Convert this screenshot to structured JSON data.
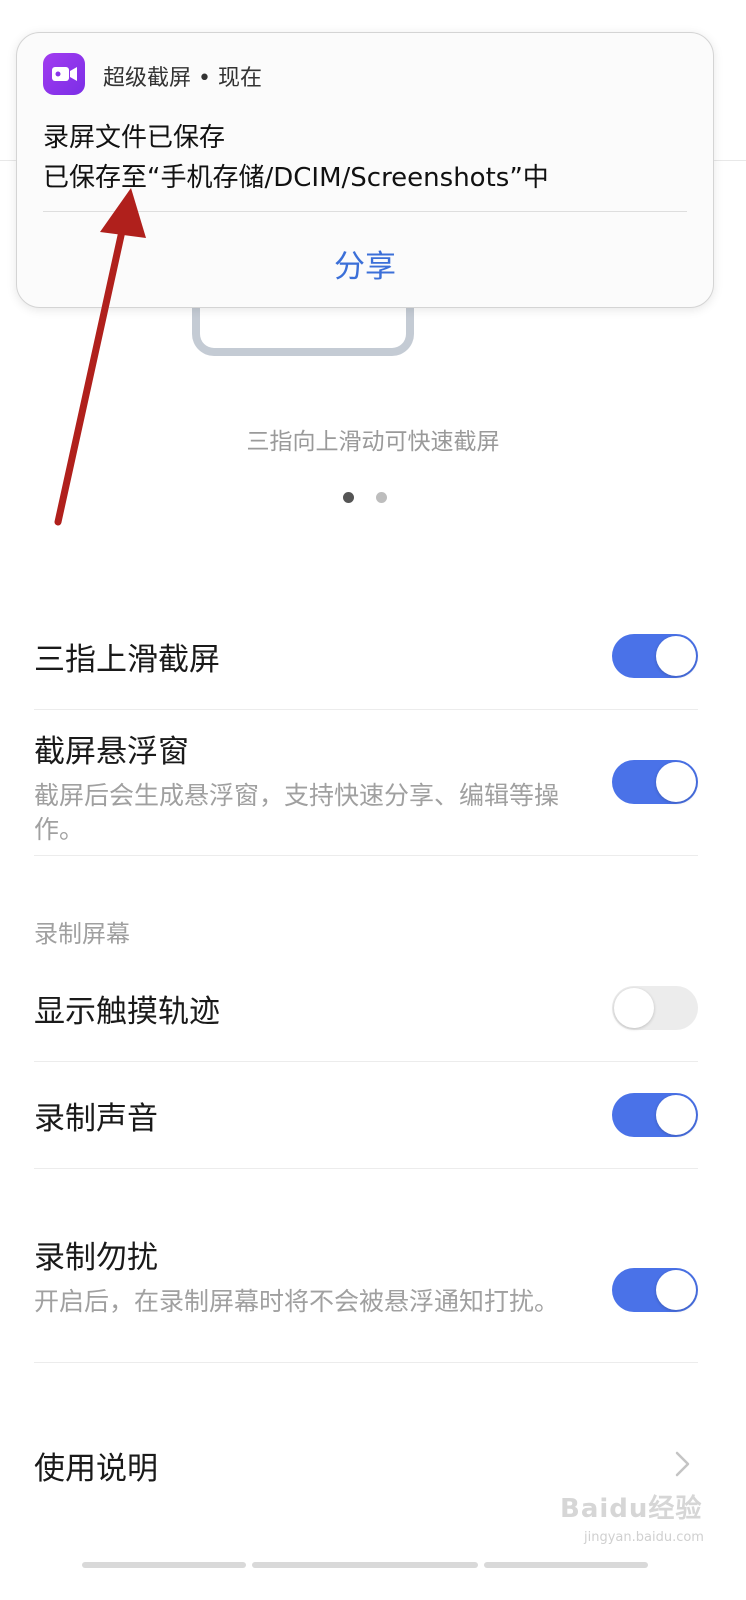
{
  "notification": {
    "app_name": "超级截屏 • 现在",
    "title": "录屏文件已保存",
    "body": "已保存至“手机存储/DCIM/Screenshots”中",
    "action_share": "分享",
    "app_icon": "video-camera-icon"
  },
  "illustration": {
    "hint": "三指向上滑动可快速截屏",
    "pages": 2,
    "current_page": 1
  },
  "settings": {
    "three_finger": {
      "label": "三指上滑截屏",
      "enabled": true
    },
    "floating_window": {
      "label": "截屏悬浮窗",
      "description": "截屏后会生成悬浮窗，支持快速分享、编辑等操作。",
      "enabled": true
    },
    "record_section_title": "录制屏幕",
    "show_touches": {
      "label": "显示触摸轨迹",
      "enabled": false
    },
    "record_sound": {
      "label": "录制声音",
      "enabled": true
    },
    "record_dnd": {
      "label": "录制勿扰",
      "description": "开启后，在录制屏幕时将不会被悬浮通知打扰。",
      "enabled": true
    },
    "instructions": {
      "label": "使用说明"
    }
  },
  "colors": {
    "accent": "#4a72e8",
    "annotation_arrow": "#b0201c",
    "share_text": "#3b6fd8"
  },
  "watermark": {
    "text": "Baidu经验",
    "sub": "jingyan.baidu.com"
  }
}
